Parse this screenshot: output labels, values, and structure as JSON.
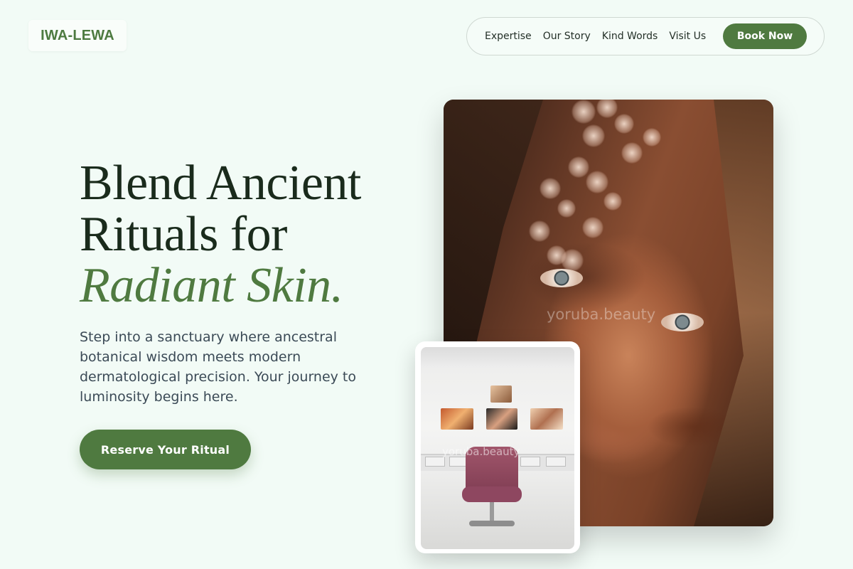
{
  "brand": {
    "logo_text": "IWA-LEWA",
    "accent_color": "#4f7a40",
    "background_color": "#f2fbf6"
  },
  "nav": {
    "links": [
      "Expertise",
      "Our Story",
      "Kind Words",
      "Visit Us"
    ],
    "cta_label": "Book Now"
  },
  "hero": {
    "title_line1": "Blend Ancient",
    "title_line2": "Rituals for",
    "title_accent": "Radiant Skin.",
    "subtitle": "Step into a sanctuary where ancestral botanical wisdom meets modern dermatological precision. Your journey to luminosity begins here.",
    "cta_label": "Reserve Your Ritual"
  },
  "images": {
    "portrait_watermark": "yoruba.beauty",
    "salon_watermark": "yoruba.beauty"
  }
}
